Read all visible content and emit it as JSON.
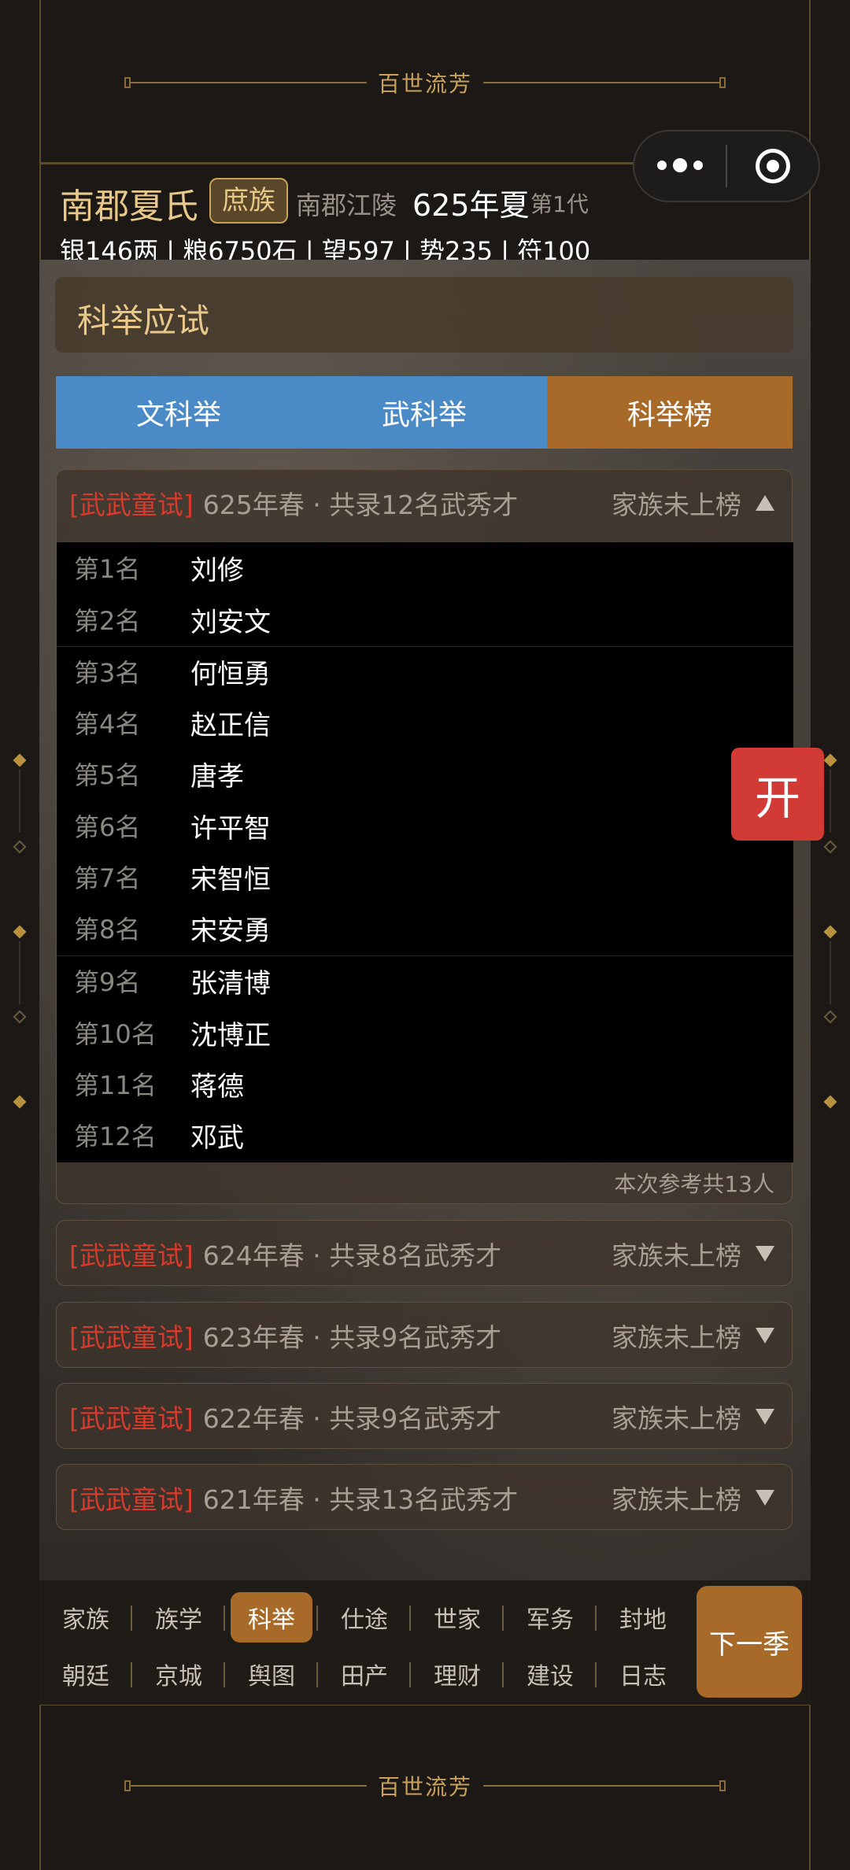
{
  "banner": {
    "title": "百世流芳"
  },
  "header": {
    "family_name": "南郡夏氏",
    "rank": "庶族",
    "location": "南郡江陵",
    "date": "625年夏",
    "generation": "第1代",
    "stats": "银146两 | 粮6750石 | 望597 | 势235 | 符100"
  },
  "section": {
    "title": "科举应试"
  },
  "tabs": [
    {
      "label": "文科举",
      "active": false
    },
    {
      "label": "武科举",
      "active": false
    },
    {
      "label": "科举榜",
      "active": true
    }
  ],
  "current_exam": {
    "tag": "[武武童试]",
    "info": "625年春 · 共录12名武秀才",
    "status": "家族未上榜",
    "expanded": true,
    "rankings": [
      {
        "rank": "第1名",
        "name": "刘修"
      },
      {
        "rank": "第2名",
        "name": "刘安文"
      },
      {
        "rank": "第3名",
        "name": "何恒勇"
      },
      {
        "rank": "第4名",
        "name": "赵正信"
      },
      {
        "rank": "第5名",
        "name": "唐孝"
      },
      {
        "rank": "第6名",
        "name": "许平智"
      },
      {
        "rank": "第7名",
        "name": "宋智恒"
      },
      {
        "rank": "第8名",
        "name": "宋安勇"
      },
      {
        "rank": "第9名",
        "name": "张清博"
      },
      {
        "rank": "第10名",
        "name": "沈博正"
      },
      {
        "rank": "第11名",
        "name": "蒋德"
      },
      {
        "rank": "第12名",
        "name": "邓武"
      }
    ],
    "participants": "本次参考共13人"
  },
  "past_exams": [
    {
      "tag": "[武武童试]",
      "info": "624年春 · 共录8名武秀才",
      "status": "家族未上榜"
    },
    {
      "tag": "[武武童试]",
      "info": "623年春 · 共录9名武秀才",
      "status": "家族未上榜"
    },
    {
      "tag": "[武武童试]",
      "info": "622年春 · 共录9名武秀才",
      "status": "家族未上榜"
    },
    {
      "tag": "[武武童试]",
      "info": "621年春 · 共录13名武秀才",
      "status": "家族未上榜"
    }
  ],
  "open_button": "开",
  "nav": {
    "row1": [
      "家族",
      "族学",
      "科举",
      "仕途",
      "世家",
      "军务",
      "封地"
    ],
    "row2": [
      "朝廷",
      "京城",
      "舆图",
      "田产",
      "理财",
      "建设",
      "日志"
    ],
    "active": "科举",
    "next_label": "下一季"
  },
  "colors": {
    "accent_gold": "#c9a15a",
    "tab_blue": "#4a8ac6",
    "tab_active": "#a86a28",
    "exam_tag_red": "#d83a2c",
    "open_red": "#d13a35"
  }
}
